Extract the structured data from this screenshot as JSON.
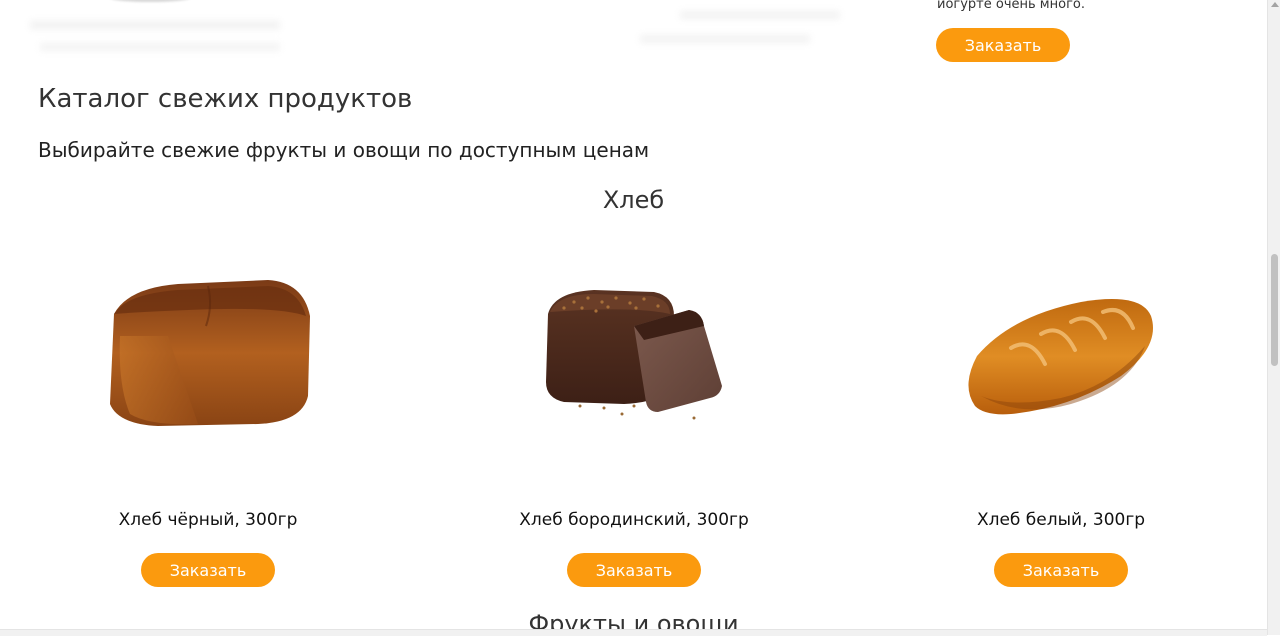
{
  "top": {
    "description_tail": "йогурте очень много.",
    "order_label": "Заказать"
  },
  "catalog": {
    "title": "Каталог свежих продуктов",
    "subtitle": "Выбирайте свежие фрукты и овощи по доступным ценам"
  },
  "category": {
    "title": "Хлеб"
  },
  "products": [
    {
      "name": "Хлеб чёрный, 300гр",
      "order_label": "Заказать",
      "image": "black-bread-image"
    },
    {
      "name": "Хлеб бородинский, 300гр",
      "order_label": "Заказать",
      "image": "borodinsky-bread-image"
    },
    {
      "name": "Хлеб белый, 300гр",
      "order_label": "Заказать",
      "image": "white-bread-image"
    }
  ],
  "next_category": {
    "title": "Фрукты и овощи"
  },
  "colors": {
    "accent": "#fb9a0e",
    "text": "#333333"
  }
}
